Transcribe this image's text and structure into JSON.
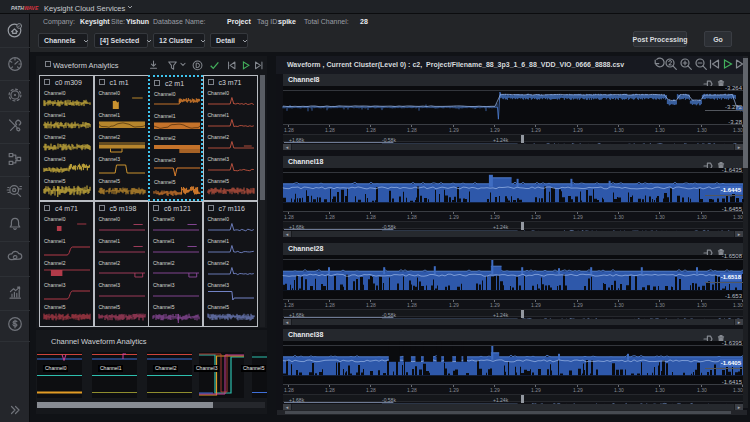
{
  "topbar": {
    "logo_path": "PATH",
    "logo_wave": "WAVE",
    "app_title": "Keysight Cloud Services"
  },
  "infobar": {
    "fields": [
      {
        "label": "Company:",
        "value": "Keysight"
      },
      {
        "label": "Site:",
        "value": "Yishun"
      },
      {
        "label": "Database Name:",
        "value": "Project"
      },
      {
        "label": "Tag ID:",
        "value": "spike"
      },
      {
        "label": "Total Channel:",
        "value": "28"
      }
    ]
  },
  "toolbar": {
    "dropdowns": [
      {
        "label": "Channels"
      },
      {
        "label": "[4] Selected"
      },
      {
        "label": "12 Cluster"
      },
      {
        "label": "Detail"
      }
    ],
    "post_processing_label": "Post Processing",
    "go_label": "Go"
  },
  "sidebar": {
    "icons": [
      {
        "name": "dashboard"
      },
      {
        "name": "gauge"
      },
      {
        "name": "gear"
      },
      {
        "name": "tools"
      },
      {
        "name": "workflow"
      },
      {
        "name": "inspect"
      },
      {
        "name": "bell"
      },
      {
        "name": "cloud-sync"
      },
      {
        "name": "chart-growth"
      },
      {
        "name": "dollar"
      },
      {
        "name": "collapse"
      }
    ]
  },
  "cluster_panel": {
    "title": "Waveform Analytics",
    "channel_names": [
      "Channel0",
      "Channel1",
      "Channel2",
      "Channel3",
      "Channel5"
    ],
    "clusters": [
      {
        "id": "c0 m309",
        "color": "#d9ba3f",
        "selected": false,
        "waves": [
          "noise",
          "noise",
          "noise",
          "noise-step",
          "noise-big"
        ]
      },
      {
        "id": "c1 m1",
        "color": "#c9922f",
        "selected": false,
        "waves": [
          "pulse-narrow",
          "band-wave",
          "band-notch",
          "pulse-up",
          "noise"
        ]
      },
      {
        "id": "c2 m1",
        "color": "#d87d2c",
        "selected": true,
        "waves": [
          "step-noise",
          "band-wave",
          "band-block",
          "spike-deep",
          "noise-raise"
        ]
      },
      {
        "id": "c3 m71",
        "color": "#c25440",
        "selected": false,
        "waves": [
          "spike-line",
          "spike-line",
          "spike-dash",
          "spike-line",
          "noise"
        ]
      },
      {
        "id": "c4 m71",
        "color": "#b23a49",
        "selected": false,
        "waves": [
          "dash-pulse",
          "rise",
          "pulse-block",
          "rise",
          "noise"
        ]
      },
      {
        "id": "c5 m198",
        "color": "#ad3f61",
        "selected": false,
        "waves": [
          "dash-line",
          "dash-line",
          "line-pulse",
          "line",
          "noise"
        ]
      },
      {
        "id": "c6 m121",
        "color": "#8f4a9e",
        "selected": false,
        "waves": [
          "dash-line",
          "dash-line",
          "line-pulse",
          "line",
          "noise-dip"
        ]
      },
      {
        "id": "c7 m116",
        "color": "#7283c5",
        "selected": false,
        "waves": [
          "spike-line",
          "spike-line",
          "spike-line",
          "drop",
          "noise"
        ]
      }
    ]
  },
  "channel_panel": {
    "title": "Channel Waveform Analytics",
    "items": [
      {
        "name": "Channel0",
        "variant": "dip"
      },
      {
        "name": "Channel1",
        "variant": "spike"
      },
      {
        "name": "Channel2",
        "variant": "flat"
      },
      {
        "name": "Channel3",
        "variant": "square"
      },
      {
        "name": "Channel5",
        "variant": "flat2"
      }
    ]
  },
  "waveform_panel": {
    "title": "Waveform , Current Cluster(Level 0) : c2,",
    "file": "Project/Filename_88_3p3_1_6_88_VDD_VIO_0666_8888.csv",
    "x_ticks": [
      "1.28",
      "1.28",
      "1.28",
      "1.28",
      "1.29",
      "1.29",
      "1.29",
      "1.29",
      "1.30",
      "1.30",
      "1.30",
      "1.30"
    ],
    "overview_labels": [
      "+1.68k",
      "-0.58k",
      "+1.24k"
    ],
    "rows": [
      {
        "name": "Channel8",
        "y_top": "-3.264",
        "y_mid": "-3.272",
        "y_bottom": "-3.28",
        "mid_chip": false,
        "wave": "step"
      },
      {
        "name": "Channel18",
        "y_top": "-1.6435",
        "y_mid": "-1.6445",
        "y_bottom": "-1.6455",
        "mid_chip": true,
        "wave": "band"
      },
      {
        "name": "Channel28",
        "y_top": "-1.6508",
        "y_mid": "-1.6518",
        "y_bottom": "-1.653",
        "mid_chip": true,
        "wave": "band-spike"
      },
      {
        "name": "Channel38",
        "y_top": "-1.6395",
        "y_mid": "-1.6405",
        "y_bottom": "-1.6415",
        "mid_chip": true,
        "wave": "band-dropout"
      }
    ]
  },
  "colors": {
    "accent_red": "#d93540",
    "wave_blue": "#4c7fd6",
    "wave_blue_fill": "#2b55a6",
    "wave_blue_light": "#a6c0ee",
    "selected_cyan": "#3fc4ee",
    "chip_blue": "#3a65bb",
    "icon_green": "#43b05c"
  }
}
